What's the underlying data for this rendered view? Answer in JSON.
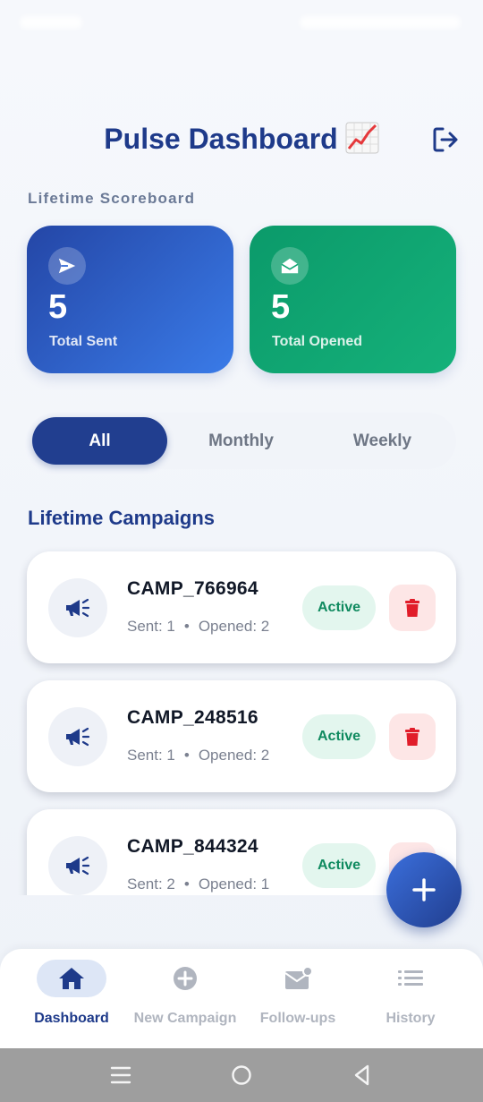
{
  "header": {
    "title": "Pulse Dashboard"
  },
  "scoreboard": {
    "label": "Lifetime Scoreboard",
    "sent": {
      "value": "5",
      "label": "Total Sent",
      "icon": "send-icon"
    },
    "opened": {
      "value": "5",
      "label": "Total Opened",
      "icon": "open-envelope-icon"
    }
  },
  "filters": {
    "tabs": [
      "All",
      "Monthly",
      "Weekly"
    ],
    "selected": "All"
  },
  "campaigns": {
    "title": "Lifetime Campaigns",
    "items": [
      {
        "name": "CAMP_766964",
        "sent_label": "Sent: 1",
        "opened_label": "Opened: 2",
        "status": "Active"
      },
      {
        "name": "CAMP_248516",
        "sent_label": "Sent: 1",
        "opened_label": "Opened: 2",
        "status": "Active"
      },
      {
        "name": "CAMP_844324",
        "sent_label": "Sent: 2",
        "opened_label": "Opened: 1",
        "status": "Active"
      }
    ],
    "separator": "•"
  },
  "nav": {
    "items": [
      {
        "label": "Dashboard",
        "icon": "home-icon",
        "active": true
      },
      {
        "label": "New Campaign",
        "icon": "plus-circle-icon",
        "active": false
      },
      {
        "label": "Follow-ups",
        "icon": "mail-notification-icon",
        "active": false
      },
      {
        "label": "History",
        "icon": "list-icon",
        "active": false
      }
    ]
  },
  "colors": {
    "primary": "#1e3a8a",
    "sent_card": "#2f5fd0",
    "opened_card": "#10a471",
    "active_badge_bg": "#e3f6ee",
    "active_badge_text": "#0f8a5f",
    "delete_bg": "#fde6e6",
    "delete_icon": "#e11d2a"
  }
}
